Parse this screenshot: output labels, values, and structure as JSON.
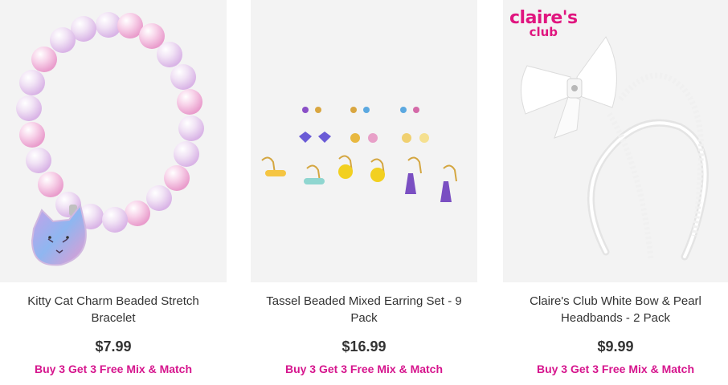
{
  "products": [
    {
      "name": "Kitty Cat Charm Beaded Stretch Bracelet",
      "price": "$7.99",
      "promo": "Buy 3 Get 3 Free Mix & Match"
    },
    {
      "name": "Tassel Beaded Mixed Earring Set - 9 Pack",
      "price": "$16.99",
      "promo": "Buy 3 Get 3 Free Mix & Match"
    },
    {
      "name": "Claire's Club White Bow & Pearl Headbands - 2 Pack",
      "price": "$9.99",
      "promo": "Buy 3 Get 3 Free Mix & Match",
      "badge_line1": "claire's",
      "badge_line2": "club"
    }
  ],
  "colors": {
    "promo": "#d6158d",
    "logo": "#e0157f",
    "image_bg": "#f3f3f3"
  }
}
